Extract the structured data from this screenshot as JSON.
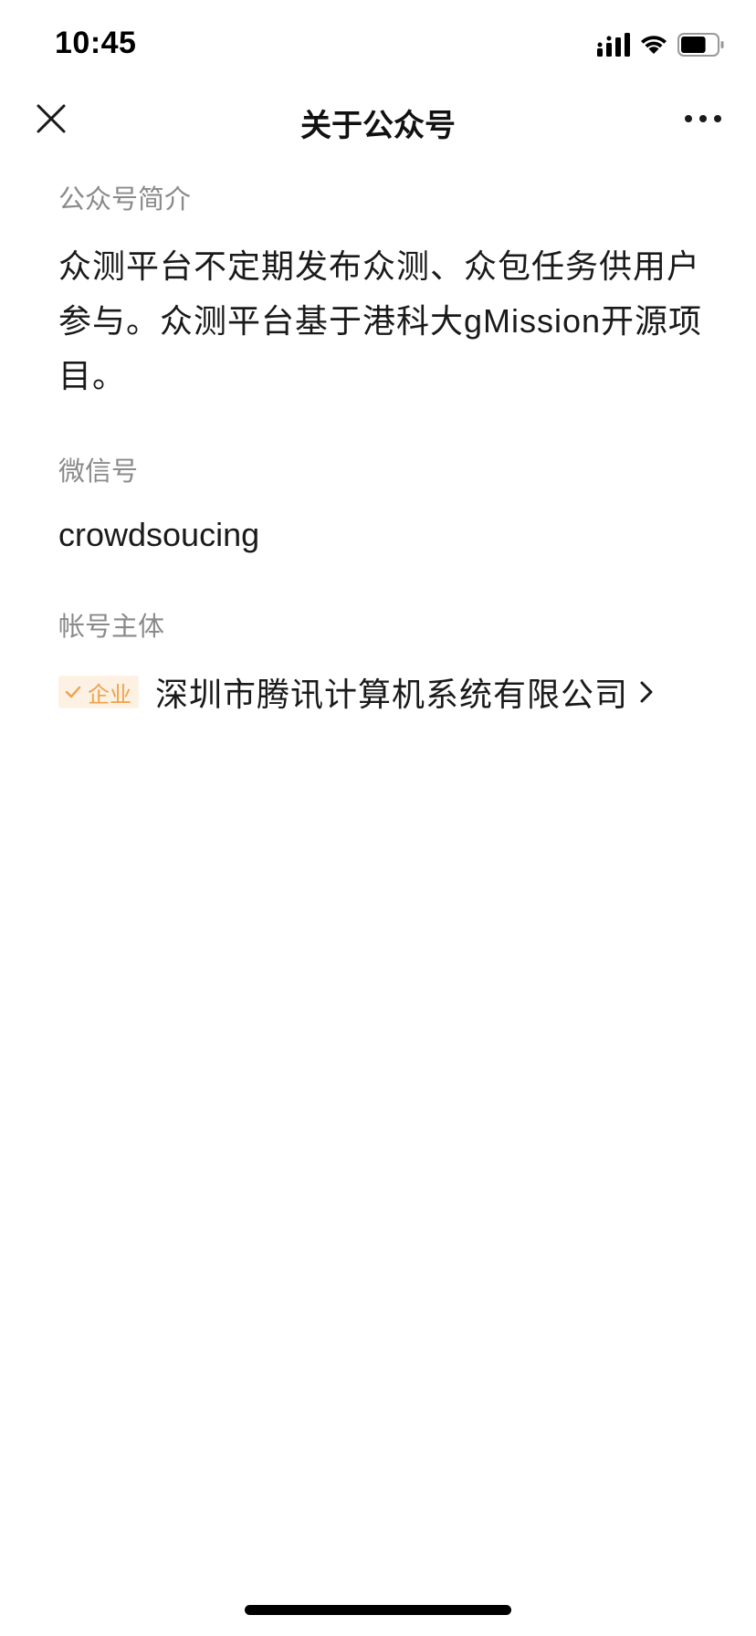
{
  "status_bar": {
    "time": "10:45",
    "icons": [
      "signal-icon",
      "wifi-icon",
      "battery-icon"
    ],
    "battery_level": 0.7
  },
  "nav": {
    "title": "关于公众号",
    "left_icon": "close-icon",
    "right_icon": "more-icon"
  },
  "intro": {
    "label": "公众号简介",
    "text": "众测平台不定期发布众测、众包任务供用户参与。众测平台基于港科大gMission开源项目。"
  },
  "wechat": {
    "label": "微信号",
    "id": "crowdsoucing"
  },
  "subject": {
    "label": "帐号主体",
    "badge": "企业",
    "badge_icon": "check-icon",
    "company": "深圳市腾讯计算机系统有限公司",
    "chevron_icon": "chevron-right-icon"
  },
  "colors": {
    "badge_bg": "#fdf1e4",
    "badge_fg": "#f0a14b",
    "label": "#8a8a8a",
    "text": "#1a1a1a"
  }
}
